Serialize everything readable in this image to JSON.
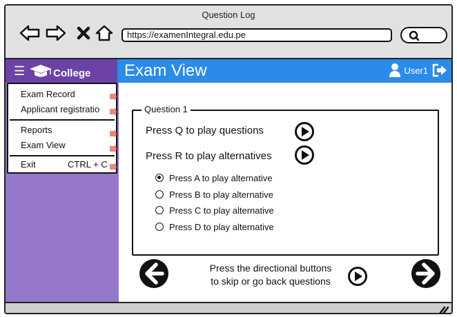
{
  "window": {
    "title": "Question Log",
    "url": "https://examenIntegral.edu.pe"
  },
  "icons": {
    "back": "arrow-left-icon",
    "forward": "arrow-right-icon",
    "stop": "close-icon",
    "home": "home-icon",
    "search": "search-icon",
    "menu": "hamburger-icon",
    "brand": "graduation-cap-icon",
    "user": "user-icon",
    "logout": "logout-icon",
    "play": "play-icon",
    "previous": "previous-icon",
    "next": "next-icon"
  },
  "colors": {
    "appbar": "#2b8be8",
    "brand": "#6b43a6",
    "sidebar": "#9578c9",
    "menu_arrow": "#e8877a",
    "chrome": "#e1e1e1"
  },
  "header": {
    "brand": "College",
    "page_title": "Exam View",
    "user": "User1"
  },
  "menu": {
    "items": [
      {
        "label": "Exam Record"
      },
      {
        "label": "Applicant registratio"
      },
      {
        "label": "Reports"
      },
      {
        "label": "Exam View"
      },
      {
        "label": "Exit",
        "shortcut": "CTRL + C"
      }
    ]
  },
  "question": {
    "legend": "Question 1",
    "play_question": "Press Q to play questions",
    "play_alternatives": "Press R to play alternatives",
    "options": [
      {
        "label": "Press A to play alternative",
        "selected": true
      },
      {
        "label": "Press B to play alternative",
        "selected": false
      },
      {
        "label": "Press C to play alternative",
        "selected": false
      },
      {
        "label": "Press D to play alternative",
        "selected": false
      }
    ]
  },
  "footer": {
    "line1": "Press the directional buttons",
    "line2": "to skip or go back questions"
  }
}
